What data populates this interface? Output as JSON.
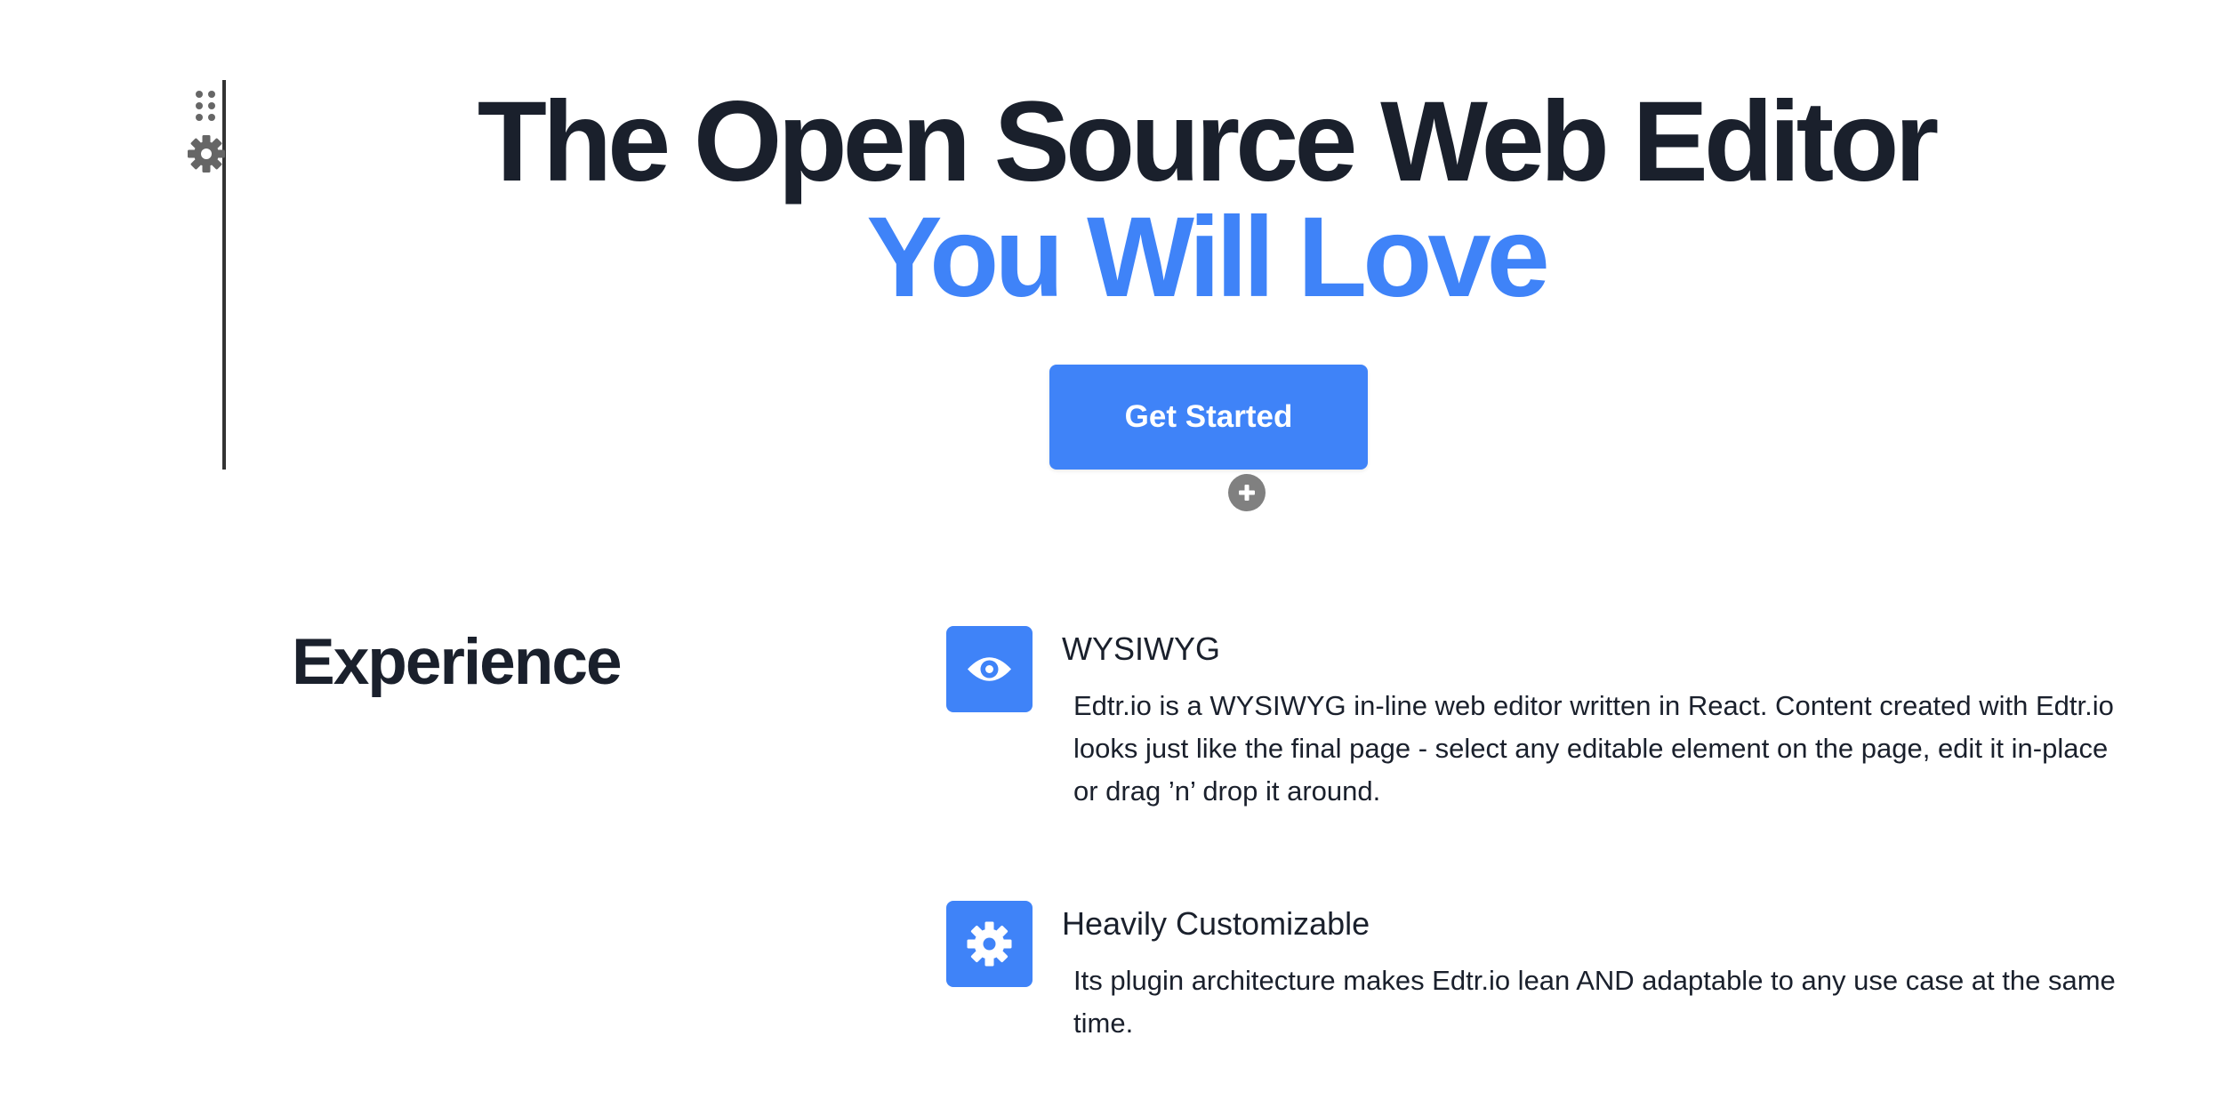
{
  "toolbar": {
    "drag_icon": "drag-handle-icon",
    "settings_icon": "gear-icon",
    "add_icon": "plus-circle-icon"
  },
  "hero": {
    "title_line1": "The Open Source Web Editor",
    "title_line2": "You Will Love",
    "cta_label": "Get Started"
  },
  "experience": {
    "heading": "Experience",
    "features": [
      {
        "icon": "eye-icon",
        "title": "WYSIWYG",
        "description": "Edtr.io is a WYSIWYG in-line web editor written in React. Content created with Edtr.io looks just like the final page - select any editable element on the page, edit it in-place or drag ’n’ drop it around."
      },
      {
        "icon": "gear-icon",
        "title": "Heavily Customizable",
        "description": "Its plugin architecture makes Edtr.io lean AND adaptable to any use case at the same time."
      }
    ]
  },
  "colors": {
    "accent": "#3f83f8",
    "text": "#1a202c",
    "toolbar_icon": "#666666"
  }
}
